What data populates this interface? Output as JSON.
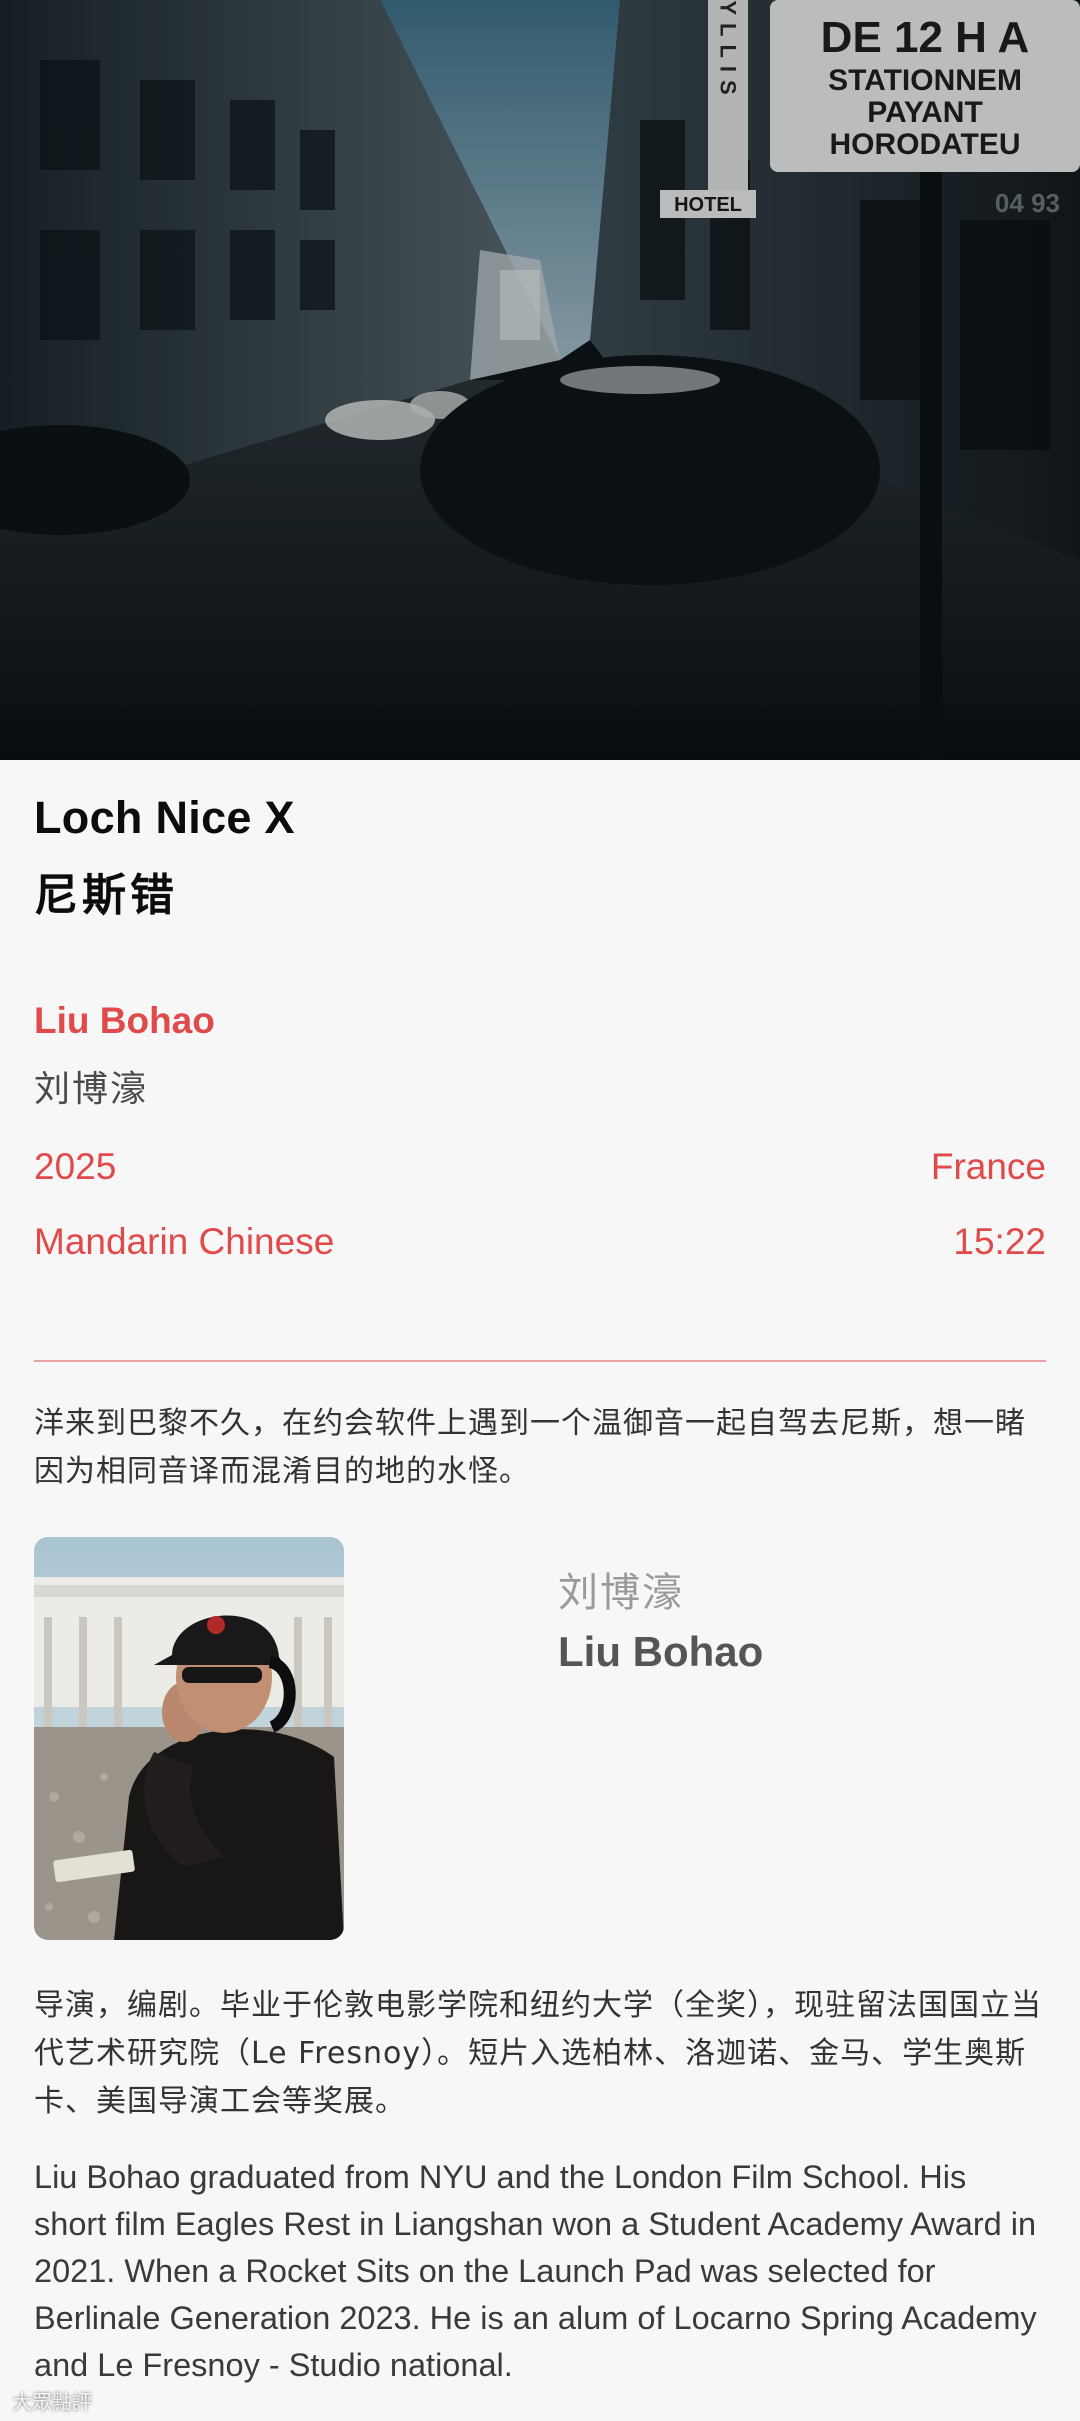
{
  "hero": {
    "image_semantic": "street-scene-still",
    "signs": {
      "hotel_vertical": "RYLLIS",
      "hotel_label": "HOTEL",
      "parking_line1": "DE 12 H A",
      "parking_line2": "STATIONNEM",
      "parking_line3": "PAYANT",
      "parking_line4": "HORODATEU",
      "corner_number": "04 93"
    }
  },
  "film": {
    "title_en": "Loch Nice X",
    "title_zh": "尼斯错",
    "director_en": "Liu Bohao",
    "director_zh": "刘博濠",
    "year": "2025",
    "country": "France",
    "language": "Mandarin Chinese",
    "duration": "15:22",
    "synopsis_zh": "洋来到巴黎不久，在约会软件上遇到一个温御音一起自驾去尼斯，想一睹因为相同音译而混淆目的地的水怪。"
  },
  "director_card": {
    "name_zh": "刘博濠",
    "name_en": "Liu Bohao",
    "portrait_semantic": "director-portrait"
  },
  "bio": {
    "zh": "导演，编剧。毕业于伦敦电影学院和纽约大学（全奖），现驻留法国国立当代艺术研究院（Le Fresnoy）。短片入选柏林、洛迦诺、金马、学生奥斯卡、美国导演工会等奖展。",
    "en": "Liu Bohao graduated from NYU and the London Film School. His short film Eagles Rest in Liangshan won a Student Academy Award in 2021. When a Rocket Sits on the Launch Pad was selected for Berlinale Generation 2023. He is an alum of Locarno Spring Academy and Le Fresnoy - Studio national."
  },
  "watermark": "大眾點評",
  "colors": {
    "accent": "#e04a4a",
    "divider": "#e8a3a3",
    "background": "#f7f7f7",
    "title": "#0c0c0c"
  }
}
